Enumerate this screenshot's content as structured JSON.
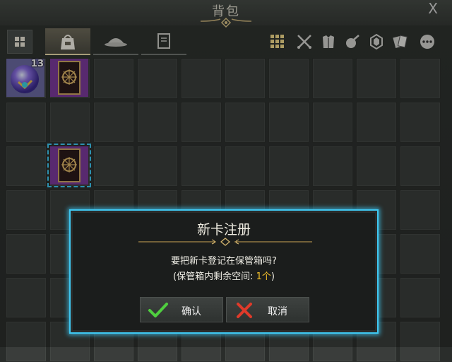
{
  "window": {
    "title": "背包",
    "close_label": "X"
  },
  "tabs": [
    {
      "name": "tab-bag",
      "active": true
    },
    {
      "name": "tab-appearance",
      "active": false
    },
    {
      "name": "tab-cards",
      "active": false
    }
  ],
  "filters": [
    "all-filter-icon",
    "weapon-filter-icon",
    "armor-filter-icon",
    "potion-filter-icon",
    "gem-filter-icon",
    "card-filter-icon",
    "more-filter-icon"
  ],
  "inventory": {
    "items": [
      {
        "kind": "orb",
        "count": "13",
        "row": 0,
        "col": 0
      },
      {
        "kind": "card",
        "count": "",
        "row": 0,
        "col": 1
      },
      {
        "kind": "card",
        "count": "",
        "row": 2,
        "col": 1,
        "selected": true
      }
    ]
  },
  "dialog": {
    "title": "新卡注册",
    "message": "要把新卡登记在保管箱吗?",
    "storage_prefix": "(保管箱内剩余空间: ",
    "storage_value": "1个",
    "storage_suffix": ")",
    "confirm_label": "确认",
    "cancel_label": "取消"
  },
  "colors": {
    "accent": "#3fc8f2",
    "highlight": "#f3c02a",
    "card_purple": "#7a3a9a"
  }
}
